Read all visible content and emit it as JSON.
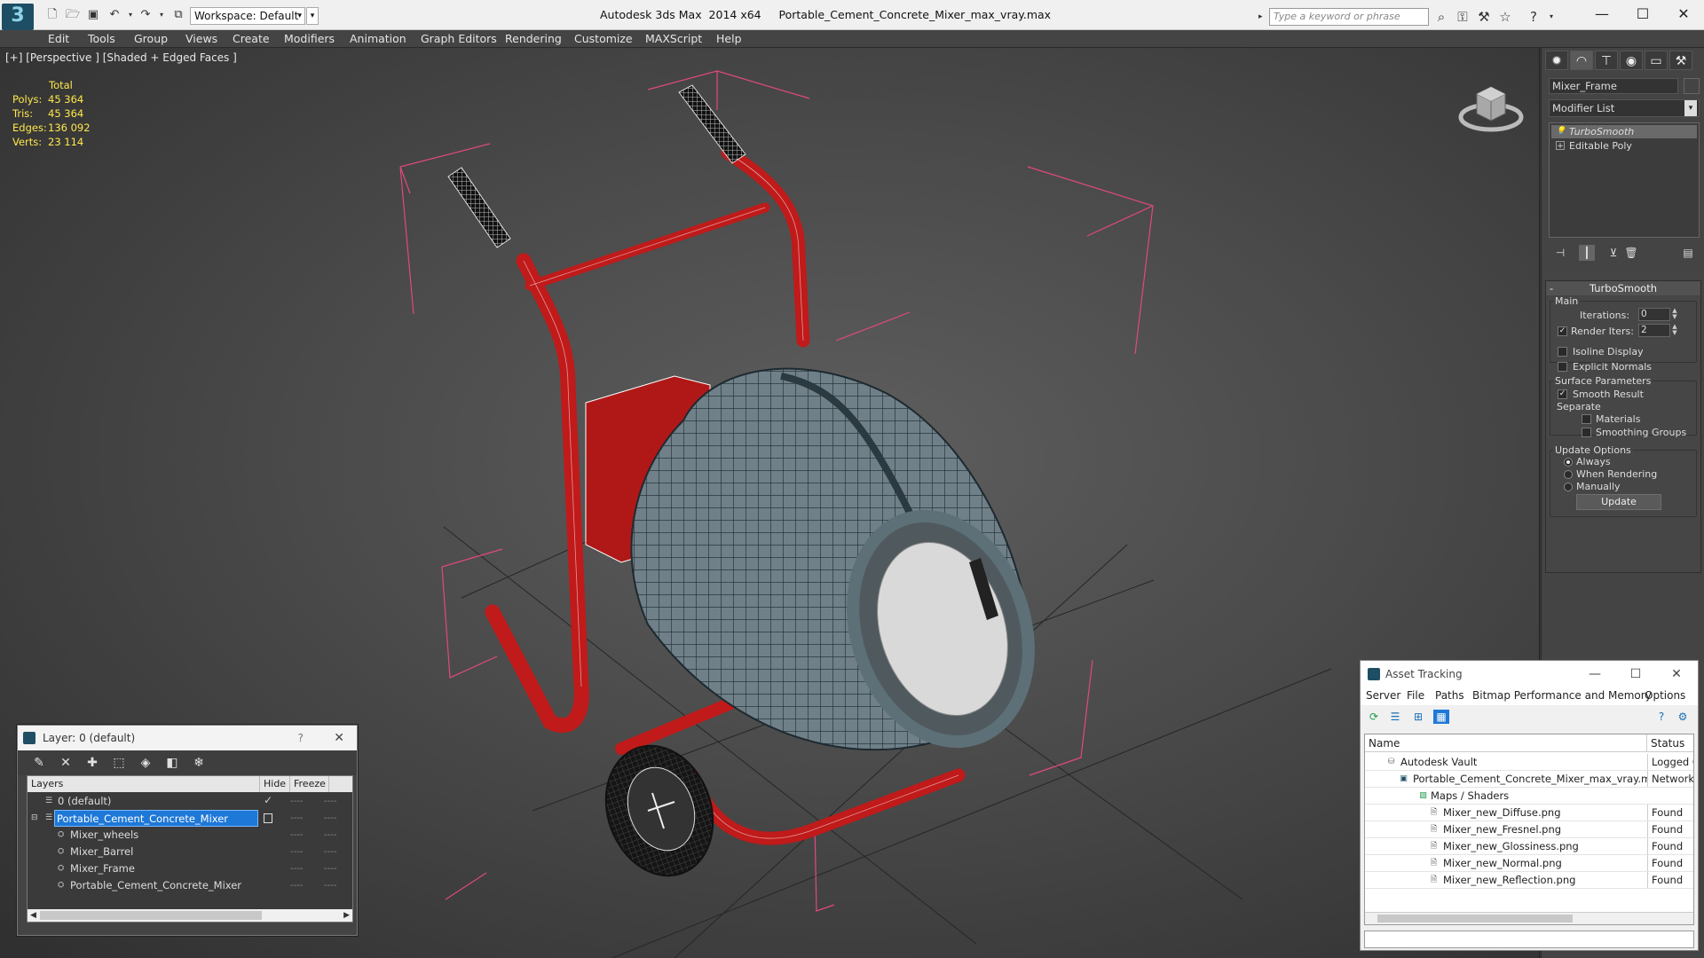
{
  "titlebar": {
    "logo": "3",
    "workspace": "Workspace: Default",
    "app_title": "Autodesk 3ds Max  2014 x64",
    "file_title": "Portable_Cement_Concrete_Mixer_max_vray.max",
    "search_placeholder": "Type a keyword or phrase"
  },
  "menu": [
    "Edit",
    "Tools",
    "Group",
    "Views",
    "Create",
    "Modifiers",
    "Animation",
    "Graph Editors",
    "Rendering",
    "Customize",
    "MAXScript",
    "Help"
  ],
  "viewport": {
    "label": "[+] [Perspective ] [Shaded + Edged Faces ]",
    "stats": {
      "total": "Total",
      "rows": [
        {
          "label": "Polys:",
          "value": "45 364"
        },
        {
          "label": "Tris:",
          "value": "45 364"
        },
        {
          "label": "Edges:",
          "value": "136 092"
        },
        {
          "label": "Verts:",
          "value": "23 114"
        }
      ]
    }
  },
  "command_panel": {
    "object_name": "Mixer_Frame",
    "modifier_list": "Modifier List",
    "stack": [
      "TurboSmooth",
      "Editable Poly"
    ],
    "turbosmooth": {
      "title": "TurboSmooth",
      "main": "Main",
      "iterations_label": "Iterations:",
      "iterations_value": "0",
      "render_iters_label": "Render Iters:",
      "render_iters_value": "2",
      "isoline": "Isoline Display",
      "explicit": "Explicit Normals",
      "surface_title": "Surface Parameters",
      "smooth_result": "Smooth Result",
      "separate": "Separate",
      "materials": "Materials",
      "smoothing_groups": "Smoothing Groups",
      "update_title": "Update Options",
      "always": "Always",
      "when_rendering": "When Rendering",
      "manually": "Manually",
      "update_btn": "Update"
    }
  },
  "layer_dialog": {
    "title": "Layer: 0 (default)",
    "help": "?",
    "headers": {
      "layers": "Layers",
      "hide": "Hide",
      "freeze": "Freeze"
    },
    "rows": [
      {
        "name": "0 (default)",
        "indent": 0
      },
      {
        "name": "Portable_Cement_Concrete_Mixer",
        "indent": 0
      },
      {
        "name": "Mixer_wheels",
        "indent": 1
      },
      {
        "name": "Mixer_Barrel",
        "indent": 1
      },
      {
        "name": "Mixer_Frame",
        "indent": 1
      },
      {
        "name": "Portable_Cement_Concrete_Mixer",
        "indent": 1
      }
    ],
    "dash": "----"
  },
  "asset_dialog": {
    "title": "Asset Tracking",
    "menu": [
      "Server",
      "File",
      "Paths",
      "Bitmap Performance and Memory",
      "Options"
    ],
    "headers": {
      "name": "Name",
      "status": "Status"
    },
    "rows": [
      {
        "name": "Autodesk Vault",
        "status": "Logged O",
        "indent": 1
      },
      {
        "name": "Portable_Cement_Concrete_Mixer_max_vray.max",
        "status": "Network P",
        "indent": 2
      },
      {
        "name": "Maps / Shaders",
        "status": "",
        "indent": 3
      },
      {
        "name": "Mixer_new_Diffuse.png",
        "status": "Found",
        "indent": 4
      },
      {
        "name": "Mixer_new_Fresnel.png",
        "status": "Found",
        "indent": 4
      },
      {
        "name": "Mixer_new_Glossiness.png",
        "status": "Found",
        "indent": 4
      },
      {
        "name": "Mixer_new_Normal.png",
        "status": "Found",
        "indent": 4
      },
      {
        "name": "Mixer_new_Reflection.png",
        "status": "Found",
        "indent": 4
      }
    ]
  },
  "colors": {
    "stats_yellow": "#ffe84a",
    "selection_blue": "#1e78d7",
    "frame_red": "#c01a1a",
    "barrel_slate": "#6f8088"
  }
}
